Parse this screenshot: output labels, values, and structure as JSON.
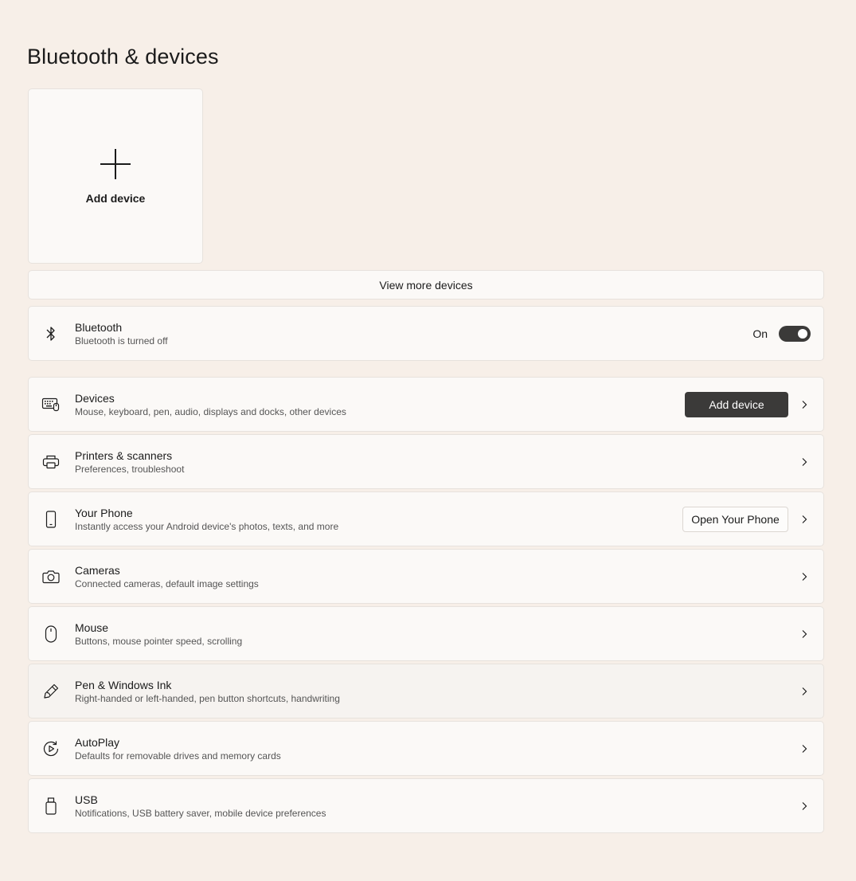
{
  "page": {
    "title": "Bluetooth & devices"
  },
  "add_tile": {
    "label": "Add device"
  },
  "view_more": {
    "label": "View more devices"
  },
  "bluetooth": {
    "title": "Bluetooth",
    "subtitle": "Bluetooth is turned off",
    "toggle_label": "On",
    "toggle_on": true
  },
  "settings": [
    {
      "key": "devices",
      "icon": "keyboard-icon",
      "title": "Devices",
      "subtitle": "Mouse, keyboard, pen, audio, displays and docks, other devices",
      "button": "Add device"
    },
    {
      "key": "printers",
      "icon": "printer-icon",
      "title": "Printers & scanners",
      "subtitle": "Preferences, troubleshoot"
    },
    {
      "key": "your-phone",
      "icon": "phone-icon",
      "title": "Your Phone",
      "subtitle": "Instantly access your Android device's photos, texts, and more",
      "button": "Open Your Phone"
    },
    {
      "key": "cameras",
      "icon": "camera-icon",
      "title": "Cameras",
      "subtitle": "Connected cameras, default image settings"
    },
    {
      "key": "mouse",
      "icon": "mouse-icon",
      "title": "Mouse",
      "subtitle": "Buttons, mouse pointer speed, scrolling"
    },
    {
      "key": "pen",
      "icon": "pen-icon",
      "title": "Pen & Windows Ink",
      "subtitle": "Right-handed or left-handed, pen button shortcuts, handwriting"
    },
    {
      "key": "autoplay",
      "icon": "autoplay-icon",
      "title": "AutoPlay",
      "subtitle": "Defaults for removable drives and memory cards"
    },
    {
      "key": "usb",
      "icon": "usb-icon",
      "title": "USB",
      "subtitle": "Notifications, USB battery saver, mobile device preferences"
    }
  ]
}
